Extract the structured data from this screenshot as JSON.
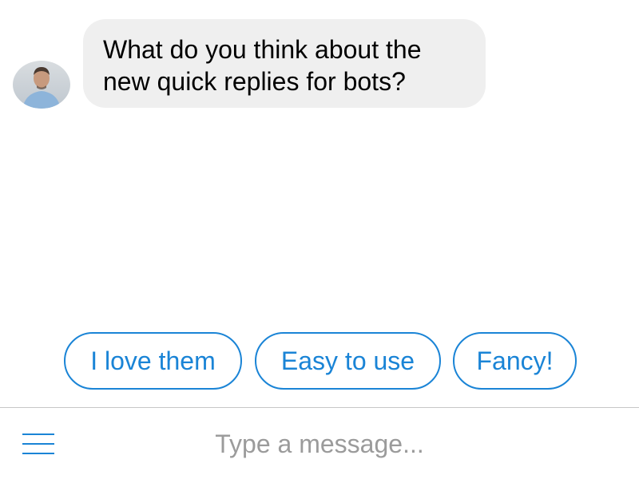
{
  "conversation": {
    "avatar_icon": "user-avatar-photo",
    "incoming_message": "What do you think about the new quick replies for bots?"
  },
  "quick_replies": [
    {
      "label": "I love them"
    },
    {
      "label": "Easy to use"
    },
    {
      "label": "Fancy!"
    }
  ],
  "composer": {
    "menu_icon": "hamburger-menu-icon",
    "placeholder": "Type a message..."
  },
  "colors": {
    "accent": "#1a84d6",
    "bubble_background": "#efefef",
    "placeholder_text": "#9b9b9b",
    "divider": "#c7c7c7"
  }
}
